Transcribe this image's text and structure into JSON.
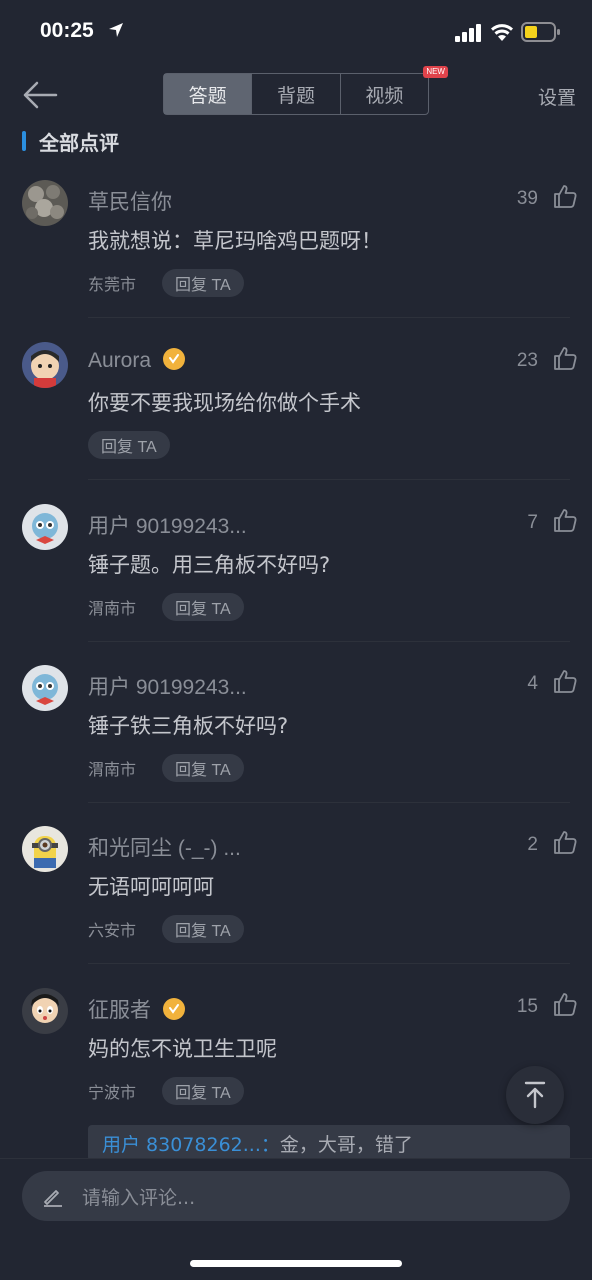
{
  "status_bar": {
    "time": "00:25"
  },
  "nav": {
    "tabs": [
      {
        "label": "答题",
        "active": true
      },
      {
        "label": "背题",
        "active": false
      },
      {
        "label": "视频",
        "active": false,
        "badge": "NEW"
      }
    ],
    "settings_label": "设置"
  },
  "section": {
    "title": "全部点评"
  },
  "comments": [
    {
      "name": "草民信你",
      "verified": false,
      "likes": "39",
      "text": "我就想说：草尼玛啥鸡巴题呀！",
      "city": "东莞市",
      "reply_label": "回复 TA"
    },
    {
      "name": "Aurora",
      "verified": true,
      "likes": "23",
      "text": "你要不要我现场给你做个手术",
      "city": "",
      "reply_label": "回复 TA"
    },
    {
      "name": "用户 90199243...",
      "verified": false,
      "likes": "7",
      "text": "锤子题。用三角板不好吗?",
      "city": "渭南市",
      "reply_label": "回复 TA"
    },
    {
      "name": "用户 90199243...",
      "verified": false,
      "likes": "4",
      "text": "锤子铁三角板不好吗?",
      "city": "渭南市",
      "reply_label": "回复 TA"
    },
    {
      "name": "和光同尘 (-_-) ...",
      "verified": false,
      "likes": "2",
      "text": "无语呵呵呵呵",
      "city": "六安市",
      "reply_label": "回复 TA"
    },
    {
      "name": "征服者",
      "verified": true,
      "likes": "15",
      "text": "妈的怎不说卫生卫呢",
      "city": "宁波市",
      "reply_label": "回复 TA"
    }
  ],
  "sub_reply": {
    "user": "用户 83078262...：",
    "text": "金，大哥，错了"
  },
  "input": {
    "placeholder": "请输入评论..."
  },
  "colors": {
    "background": "#222632",
    "accent": "#2b8fe0",
    "verified": "#f1b23c",
    "badge": "#e0434b"
  }
}
